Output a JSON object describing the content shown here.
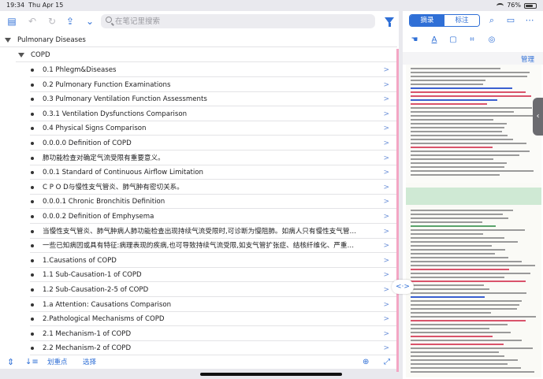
{
  "status": {
    "time": "19:34",
    "date": "Thu Apr 15",
    "battery_text": "76%",
    "battery_level": 0.76
  },
  "search": {
    "placeholder": "在笔记里搜索"
  },
  "toolbar": {
    "icons": [
      "sidebar-icon",
      "undo-icon",
      "redo-icon",
      "share-icon",
      "chevron-down-icon",
      "search-icon",
      "filter-icon"
    ]
  },
  "tree": {
    "root": "Pulmonary Diseases",
    "child": "COPD",
    "items": [
      "0.1 Phlegm&Diseases",
      "0.2 Pulmonary Function Examinations",
      "0.3 Pulmonary Ventilation Function Assessments",
      "0.3.1 Ventilation Dysfunctions Comparison",
      "0.4 Physical Signs Comparison",
      "0.0.0.0 Definition of COPD",
      "肺功能检查对确定气流受限有重要意义。",
      "0.0.1 Standard of Continuous Airflow Limitation",
      "C P O D与慢性支气管炎、肺气肿有密切关系。",
      "0.0.0.1 Chronic Bronchitis Definition",
      "0.0.0.2 Definition of Emphysema",
      "当慢性支气管炎、肺气肿病人肺功能检查出现持续气流受限时,可诊断为慢阻肺。如病人只有慢性支气管炎、肺气",
      "一些已知病因或具有特征:病理表现的疾病,也可导致持续气流受限,如支气管扩张症、结核纤维化、严重的间质性",
      "1.Causations of COPD",
      "1.1 Sub-Causation-1 of COPD",
      "1.2 Sub-Causation-2-5 of COPD",
      "1.a Attention: Causations Comparison",
      "2.Pathological Mechanisms of COPD",
      "2.1 Mechanism-1 of COPD",
      "2.2 Mechanism-2 of COPD"
    ]
  },
  "bottom": {
    "highlight_label": "划重点",
    "select_label": "选择"
  },
  "right": {
    "tab_excerpt": "摘录",
    "tab_mark": "标注",
    "manage_label": "管理",
    "split_label": "<·>"
  },
  "colors": {
    "accent": "#2f6fd6",
    "scroll_pink": "#f3a6c4",
    "page_band": "#cfe9d4"
  }
}
